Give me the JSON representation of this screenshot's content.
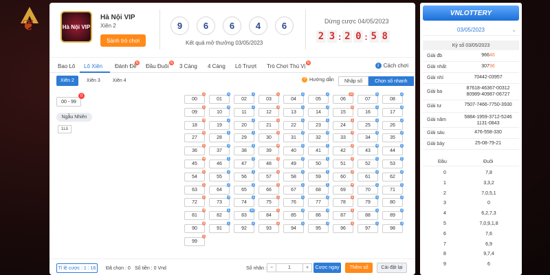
{
  "header": {
    "game_name": "Hà Nội VIP",
    "game_sub": "Xiên 2",
    "lobby_btn": "Sảnh trò chơi",
    "logo_text": "Hà Nội VIP",
    "balls": [
      "9",
      "6",
      "6",
      "4",
      "6"
    ],
    "result_label": "Kết quả mở thưởng 03/05/2023",
    "next_label": "Dừng cược 04/05/2023",
    "timer": [
      "2",
      "3",
      "2",
      "0",
      "5",
      "8"
    ]
  },
  "tabs": [
    {
      "label": "Bao Lô"
    },
    {
      "label": "Lô Xiên"
    },
    {
      "label": "Đánh Đề"
    },
    {
      "label": "Đầu Đuôi"
    },
    {
      "label": "3 Càng"
    },
    {
      "label": "4 Càng"
    },
    {
      "label": "Lô Trượt"
    },
    {
      "label": "Trò Chơi Thú Vị"
    }
  ],
  "help_label": "Cách chơi",
  "subtabs": [
    {
      "label": "Xiên 2"
    },
    {
      "label": "Xiên 3"
    },
    {
      "label": "Xiên 4"
    }
  ],
  "guide_label": "Hướng dẫn",
  "mode": {
    "manual": "Nhập số",
    "quick": "Chọn số nhanh"
  },
  "range_label": "00 - 99",
  "range_badge": "0",
  "random_label": "Ngẫu Nhiên",
  "one_lo_label": "1Lô",
  "numbers": [
    "00",
    "01",
    "02",
    "03",
    "04",
    "05",
    "06",
    "07",
    "08",
    "09",
    "10",
    "11",
    "12",
    "13",
    "14",
    "15",
    "16",
    "17",
    "18",
    "19",
    "20",
    "21",
    "22",
    "23",
    "24",
    "25",
    "26",
    "27",
    "28",
    "29",
    "30",
    "31",
    "32",
    "33",
    "34",
    "35",
    "36",
    "37",
    "38",
    "39",
    "40",
    "41",
    "42",
    "43",
    "44",
    "45",
    "46",
    "47",
    "48",
    "49",
    "50",
    "51",
    "52",
    "53",
    "54",
    "55",
    "56",
    "57",
    "58",
    "59",
    "60",
    "61",
    "62",
    "63",
    "64",
    "65",
    "66",
    "67",
    "68",
    "69",
    "70",
    "71",
    "72",
    "73",
    "74",
    "75",
    "76",
    "77",
    "78",
    "79",
    "80",
    "81",
    "82",
    "83",
    "84",
    "85",
    "86",
    "87",
    "88",
    "89",
    "90",
    "91",
    "92",
    "93",
    "94",
    "95",
    "96",
    "97",
    "98",
    "99"
  ],
  "badges": {
    "00": "2",
    "01": "5",
    "02": "2",
    "03": "1",
    "04": "2",
    "05": "2",
    "06": "10",
    "07": "5",
    "08": "2",
    "09": "1",
    "10": "8",
    "11": "2",
    "12": "3",
    "13": "1",
    "14": "3",
    "15": "6",
    "16": "1",
    "17": "3",
    "18": "4",
    "19": "2",
    "20": "2",
    "21": "1",
    "22": "1",
    "23": "1",
    "24": "1",
    "25": "1",
    "26": "2",
    "27": "6",
    "28": "1",
    "29": "1",
    "30": "1",
    "31": "2",
    "32": "3",
    "33": "3",
    "34": "3",
    "35": "2",
    "36": "1",
    "37": "3",
    "38": "1",
    "39": "4",
    "40": "1",
    "41": "1",
    "42": "2",
    "43": "4",
    "44": "1",
    "45": "4",
    "46": "1",
    "47": "2",
    "48": "3",
    "49": "2",
    "50": "1",
    "51": "2",
    "52": "1",
    "53": "1",
    "54": "1",
    "55": "2",
    "56": "1",
    "57": "1",
    "58": "1",
    "59": "1",
    "60": "2",
    "61": "2",
    "62": "2",
    "63": "1",
    "64": "2",
    "65": "2",
    "66": "1",
    "67": "1",
    "68": "1",
    "69": "4",
    "70": "1",
    "71": "1",
    "72": "1",
    "73": "4",
    "74": "1",
    "75": "1",
    "76": "1",
    "77": "2",
    "78": "1",
    "79": "1",
    "80": "2",
    "81": "4",
    "82": "1",
    "83": "10",
    "84": "1",
    "85": "3",
    "86": "3",
    "87": "1",
    "88": "1",
    "89": "2",
    "90": "3",
    "91": "1",
    "92": "2",
    "93": "2",
    "94": "1",
    "95": "3",
    "96": "1",
    "97": "1",
    "98": "3",
    "99": "1"
  },
  "footer": {
    "ratio_label": "Tỉ lệ cược : 1 : 16",
    "selected": "Đã chọn : 0",
    "amount": "Số tiền : 0 Vnd",
    "multiplier_label": "Số nhân :",
    "minus": "−",
    "qty": "1",
    "plus": "+",
    "quick_bet": "Cược ngay",
    "add_number": "Thêm số",
    "reset": "Cài đặt lại"
  },
  "side": {
    "brand": "VNLOTTERY",
    "date": "03/05/2023",
    "kyso_label": "Kỳ số 03/05/2023",
    "results": [
      {
        "label": "Giải đb",
        "plain": "966",
        "hl": "46"
      },
      {
        "label": "Giải nhất",
        "plain": "307",
        "hl": "96"
      },
      {
        "label": "Giải nhì",
        "plain": "70442-03957",
        "hl": ""
      },
      {
        "label": "Giải ba",
        "plain": "87618-46367-00312 80989-40987-06727",
        "hl": ""
      },
      {
        "label": "Giải tư",
        "plain": "7507-7466-7750-3930",
        "hl": ""
      },
      {
        "label": "Giải năm",
        "plain": "5884-1959-3712-5246 1131-0843",
        "hl": ""
      },
      {
        "label": "Giải sáu",
        "plain": "476-558-330",
        "hl": ""
      },
      {
        "label": "Giải bảy",
        "plain": "25-08-79-21",
        "hl": ""
      }
    ],
    "dd_head": {
      "dau": "Đầu",
      "duoi": "Đuôi"
    },
    "dd": [
      {
        "dau": "0",
        "duoi": "7,8"
      },
      {
        "dau": "1",
        "duoi": "3,3,2"
      },
      {
        "dau": "2",
        "duoi": "7,0,5,1"
      },
      {
        "dau": "3",
        "duoi": "0"
      },
      {
        "dau": "4",
        "duoi": "6,2,7,3"
      },
      {
        "dau": "5",
        "duoi": "7,0,9,1,8"
      },
      {
        "dau": "6",
        "duoi": "7,6"
      },
      {
        "dau": "7",
        "duoi": "6,9"
      },
      {
        "dau": "8",
        "duoi": "9,7,4"
      },
      {
        "dau": "9",
        "duoi": "6"
      }
    ]
  },
  "colors": {
    "accent": "#2e7bd6",
    "orange": "#ff8a1a",
    "timer": "#d62d2d",
    "background": "#1a0a0a"
  }
}
